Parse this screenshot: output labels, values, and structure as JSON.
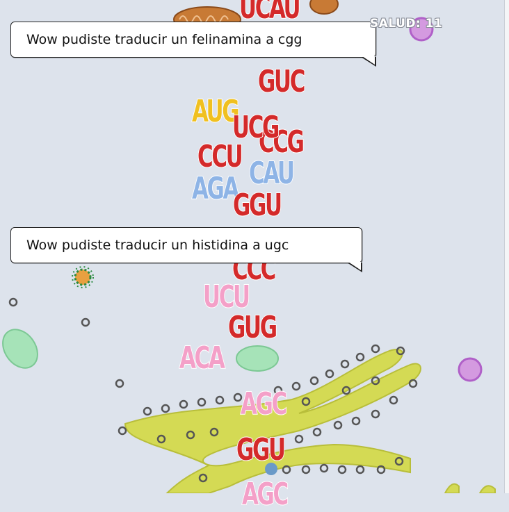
{
  "hud": {
    "health": "SALUD: 11"
  },
  "messages": [
    {
      "text": "Wow pudiste traducir un felinamina a cgg"
    },
    {
      "text": "Wow pudiste traducir un histidina a ugc"
    }
  ],
  "codons": [
    {
      "text": "UCAU",
      "color": "#d42a2a"
    },
    {
      "text": "GUC",
      "color": "#d42a2a"
    },
    {
      "text": "AUG",
      "color": "#f0c020"
    },
    {
      "text": "UCG",
      "color": "#d42a2a"
    },
    {
      "text": "CCG",
      "color": "#d42a2a"
    },
    {
      "text": "CCU",
      "color": "#d42a2a"
    },
    {
      "text": "CAU",
      "color": "#8eb4e6"
    },
    {
      "text": "AGA",
      "color": "#8eb4e6"
    },
    {
      "text": "GGU",
      "color": "#d42a2a"
    },
    {
      "text": "CCC",
      "color": "#d42a2a"
    },
    {
      "text": "UCU",
      "color": "#f4a0c8"
    },
    {
      "text": "GUG",
      "color": "#d42a2a"
    },
    {
      "text": "ACA",
      "color": "#f4a0c8"
    },
    {
      "text": "AGC",
      "color": "#f4a0c8"
    },
    {
      "text": "GGU",
      "color": "#d42a2a"
    },
    {
      "text": "AGC",
      "color": "#f4a0c8"
    }
  ],
  "scene": {
    "background": "#dde3ec",
    "er_color": "#d4da54",
    "vesicle_color": "#9edfb0",
    "lysosome_color": "#c98ad8",
    "mitochondria_color": "#c87a35",
    "ribosome_color": "#555555"
  }
}
